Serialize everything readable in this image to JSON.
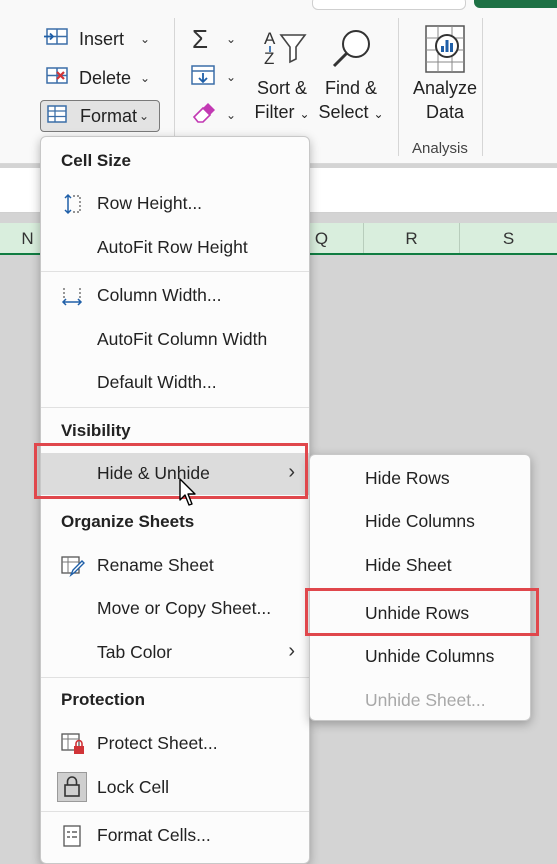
{
  "ribbon": {
    "cells": {
      "insert_label": "Insert",
      "delete_label": "Delete",
      "format_label": "Format"
    },
    "editing": {
      "sort_line1": "Sort &",
      "sort_line2": "Filter",
      "find_line1": "Find &",
      "find_line2": "Select"
    },
    "analysis": {
      "analyze_line1": "Analyze",
      "analyze_line2": "Data",
      "group_label": "Analysis"
    }
  },
  "sheet": {
    "columns": [
      "N",
      "Q",
      "R",
      "S"
    ]
  },
  "format_menu": {
    "cell_size_header": "Cell Size",
    "row_height": "Row Height...",
    "autofit_row_height": "AutoFit Row Height",
    "column_width": "Column Width...",
    "autofit_column_width": "AutoFit Column Width",
    "default_width": "Default Width...",
    "visibility_header": "Visibility",
    "hide_unhide": "Hide & Unhide",
    "organize_header": "Organize Sheets",
    "rename_sheet": "Rename Sheet",
    "move_copy_sheet": "Move or Copy Sheet...",
    "tab_color": "Tab Color",
    "protection_header": "Protection",
    "protect_sheet": "Protect Sheet...",
    "lock_cell": "Lock Cell",
    "format_cells": "Format Cells..."
  },
  "hide_unhide_submenu": {
    "hide_rows": "Hide Rows",
    "hide_columns": "Hide Columns",
    "hide_sheet": "Hide Sheet",
    "unhide_rows": "Unhide Rows",
    "unhide_columns": "Unhide Columns",
    "unhide_sheet": "Unhide Sheet..."
  },
  "colors": {
    "highlight_box": "#e0474c",
    "excel_green": "#107c41",
    "header_bg": "#d9eedd"
  }
}
